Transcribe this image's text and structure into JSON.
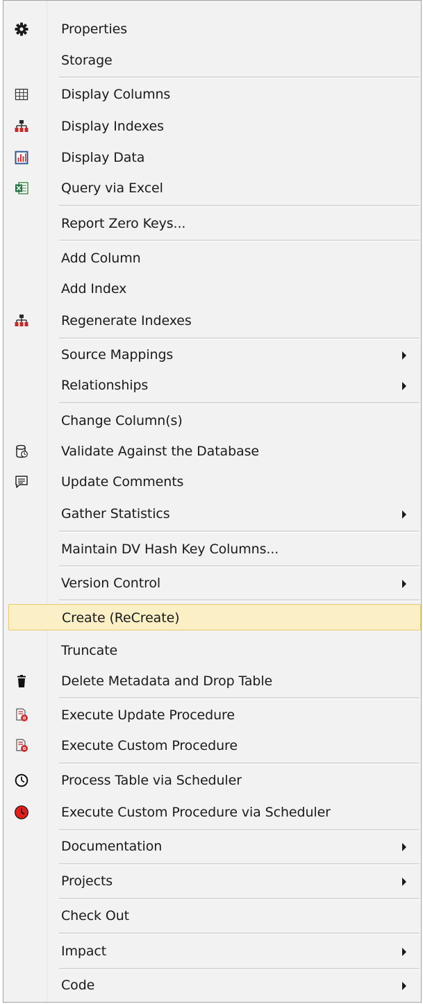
{
  "menu": {
    "items": {
      "properties": "Properties",
      "storage": "Storage",
      "display_columns": "Display Columns",
      "display_indexes": "Display Indexes",
      "display_data": "Display Data",
      "query_via_excel": "Query via Excel",
      "report_zero_keys": "Report Zero Keys...",
      "add_column": "Add Column",
      "add_index": "Add Index",
      "regenerate_indexes": "Regenerate Indexes",
      "source_mappings": "Source Mappings",
      "relationships": "Relationships",
      "change_columns": "Change Column(s)",
      "validate_against_database": "Validate Against the Database",
      "update_comments": "Update Comments",
      "gather_statistics": "Gather Statistics",
      "maintain_dv_hash_key_columns": "Maintain DV Hash Key Columns...",
      "version_control": "Version Control",
      "create_recreate": "Create (ReCreate)",
      "truncate": "Truncate",
      "delete_metadata_and_drop_table": "Delete Metadata and Drop Table",
      "execute_update_procedure": "Execute Update Procedure",
      "execute_custom_procedure": "Execute Custom Procedure",
      "process_table_via_scheduler": "Process Table via Scheduler",
      "execute_custom_procedure_via_scheduler": "Execute Custom Procedure via Scheduler",
      "documentation": "Documentation",
      "projects": "Projects",
      "check_out": "Check Out",
      "impact": "Impact",
      "code": "Code"
    },
    "highlighted_item": "Create (ReCreate)",
    "colors": {
      "background": "#f2f2f2",
      "highlight_fill": "#fbefc6",
      "highlight_border": "#e8c96d",
      "separator": "#dadada",
      "icon_red": "#d32f2f"
    }
  }
}
